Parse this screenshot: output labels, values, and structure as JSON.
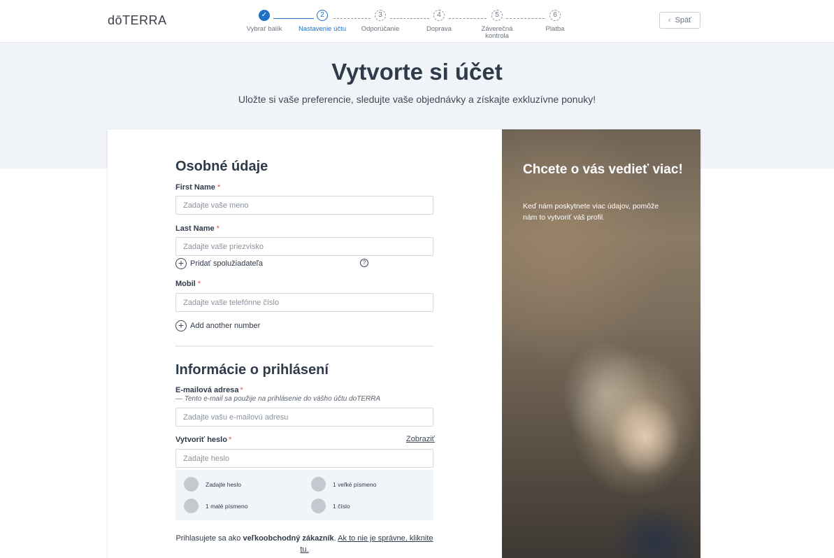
{
  "header": {
    "logo": "dōTERRA",
    "back_label": "Späť",
    "steps": [
      {
        "number": "✓",
        "label": "Vybrať balík",
        "state": "done"
      },
      {
        "number": "2",
        "label": "Nastavenie účtu",
        "state": "active"
      },
      {
        "number": "3",
        "label": "Odporúčanie",
        "state": "pending"
      },
      {
        "number": "4",
        "label": "Doprava",
        "state": "pending"
      },
      {
        "number": "5",
        "label": "Záverečná kontrola",
        "state": "pending"
      },
      {
        "number": "6",
        "label": "Platba",
        "state": "pending"
      }
    ]
  },
  "hero": {
    "title": "Vytvorte si účet",
    "subtitle": "Uložte si vaše preferencie, sledujte vaše objednávky a získajte exkluzívne ponuky!"
  },
  "personal": {
    "title": "Osobné údaje",
    "first_name_label": "First Name",
    "first_name_placeholder": "Zadajte vaše meno",
    "last_name_label": "Last Name",
    "last_name_placeholder": "Zadajte vaše priezvisko",
    "add_coapplicant": "Pridať spolužiadateľa",
    "mobile_label": "Mobil",
    "mobile_placeholder": "Zadajte vaše telefónne číslo",
    "add_number": "Add another number",
    "required_mark": "*"
  },
  "login": {
    "title": "Informácie o prihlásení",
    "email_label": "E-mailová adresa",
    "email_hint": "— Tento e-mail sa použije na prihlásenie do vášho účtu doTERRA",
    "email_placeholder": "Zadajte vašu e-mailovú adresu",
    "password_label": "Vytvoriť heslo",
    "show_label": "Zobraziť",
    "password_placeholder": "Zadajte heslo",
    "rules": [
      "Zadajte heslo",
      "1 veľké písmeno",
      "1 malé písmeno",
      "1 číslo"
    ]
  },
  "footnote": {
    "prefix": "Prihlasujete sa ako",
    "role": "veľkoobchodný zákazník",
    "link": "Ak to nie je správne, kliknite tu."
  },
  "photo_panel": {
    "title": "Chcete o vás vedieť viac!",
    "text": "Keď nám poskytnete viac údajov, pomôže nám to vytvoriť váš profil."
  }
}
